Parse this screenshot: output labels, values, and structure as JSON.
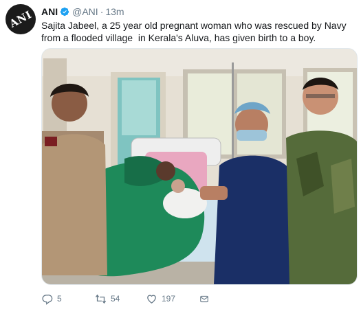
{
  "tweet": {
    "author_name": "ANI",
    "handle": "@ANI",
    "separator": "·",
    "time": "13m",
    "avatar_text": "ANI",
    "text": "Sajita Jabeel, a 25 year old pregnant woman who was rescued by Navy from a flooded village  in Kerala's Aluva, has given birth to a boy.",
    "media_icon": "photo",
    "actions": {
      "replies": "5",
      "retweets": "54",
      "likes": "197"
    }
  },
  "colors": {
    "text": "#14171a",
    "muted": "#657786",
    "verified": "#1da1f2"
  },
  "icons": [
    "verified-badge-icon",
    "reply-icon",
    "retweet-icon",
    "like-icon",
    "message-icon"
  ]
}
